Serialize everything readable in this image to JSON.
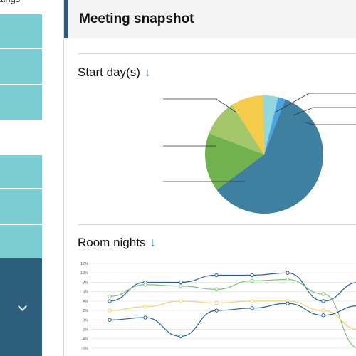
{
  "sidebar": {
    "top_label": "ettings",
    "expand_icon": "chevron-down-icon"
  },
  "header": {
    "title": "Meeting snapshot"
  },
  "sections": {
    "start_days": {
      "title": "Start day(s)",
      "sort_icon": "arrow-down-icon"
    },
    "room_nights": {
      "title": "Room nights",
      "sort_icon": "arrow-down-icon"
    }
  },
  "colors": {
    "accent": "#2d5f7d",
    "sidebar_teal": "#7cccd3",
    "sort_arrow": "#3a8fd1"
  },
  "chart_data": [
    {
      "type": "pie",
      "slices": [
        {
          "value": 59,
          "color": "#3f7fa0"
        },
        {
          "value": 16,
          "color": "#6fb24e"
        },
        {
          "value": 10,
          "color": "#a3c76a"
        },
        {
          "value": 9,
          "color": "#f4cc4a"
        },
        {
          "value": 4,
          "color": "#91d7df"
        },
        {
          "value": 2,
          "color": "#4aa4e0"
        }
      ]
    },
    {
      "type": "line",
      "y_ticks": [
        "12%",
        "10%",
        "8%",
        "6%",
        "4%",
        "2%",
        "0%",
        "-2%",
        "-4%",
        "-6%"
      ],
      "ylim": [
        -6,
        12
      ],
      "x": [
        1,
        2,
        3,
        4,
        5,
        6,
        7,
        8
      ],
      "series": [
        {
          "color": "#2b5c9e",
          "values": [
            4,
            8,
            8,
            9.5,
            9.5,
            10,
            4,
            8
          ]
        },
        {
          "color": "#7ec27a",
          "values": [
            5,
            7.5,
            7.2,
            6.5,
            8.3,
            8.6,
            5.5,
            -6
          ]
        },
        {
          "color": "#f1d36a",
          "values": [
            2,
            2.8,
            4,
            3.6,
            4,
            4,
            2,
            -2
          ]
        },
        {
          "color": "#2b5c9e",
          "values": [
            0,
            0.5,
            -3.5,
            2,
            2.5,
            3.5,
            1,
            3
          ]
        }
      ]
    }
  ]
}
